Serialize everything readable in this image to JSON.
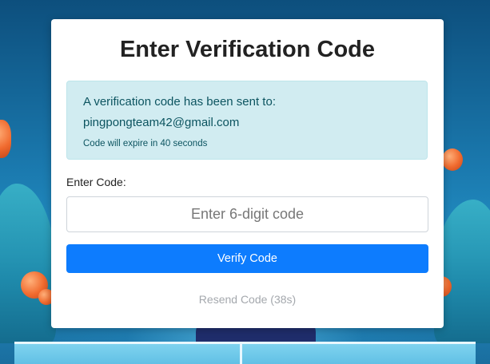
{
  "title": "Enter Verification Code",
  "alert": {
    "message": "A verification code has been sent to:",
    "email": "pingpongteam42@gmail.com",
    "expiry": "Code will expire in 40 seconds"
  },
  "form": {
    "code_label": "Enter Code:",
    "code_placeholder": "Enter 6-digit code",
    "code_value": "",
    "verify_label": "Verify Code",
    "resend_label": "Resend Code (38s)"
  },
  "colors": {
    "primary": "#0d7cfe",
    "alert_bg": "#d1ecf1",
    "alert_text": "#0c5460",
    "disabled_text": "#a4a8ad"
  },
  "background": {
    "description_icon": "ping-pong-scene"
  }
}
